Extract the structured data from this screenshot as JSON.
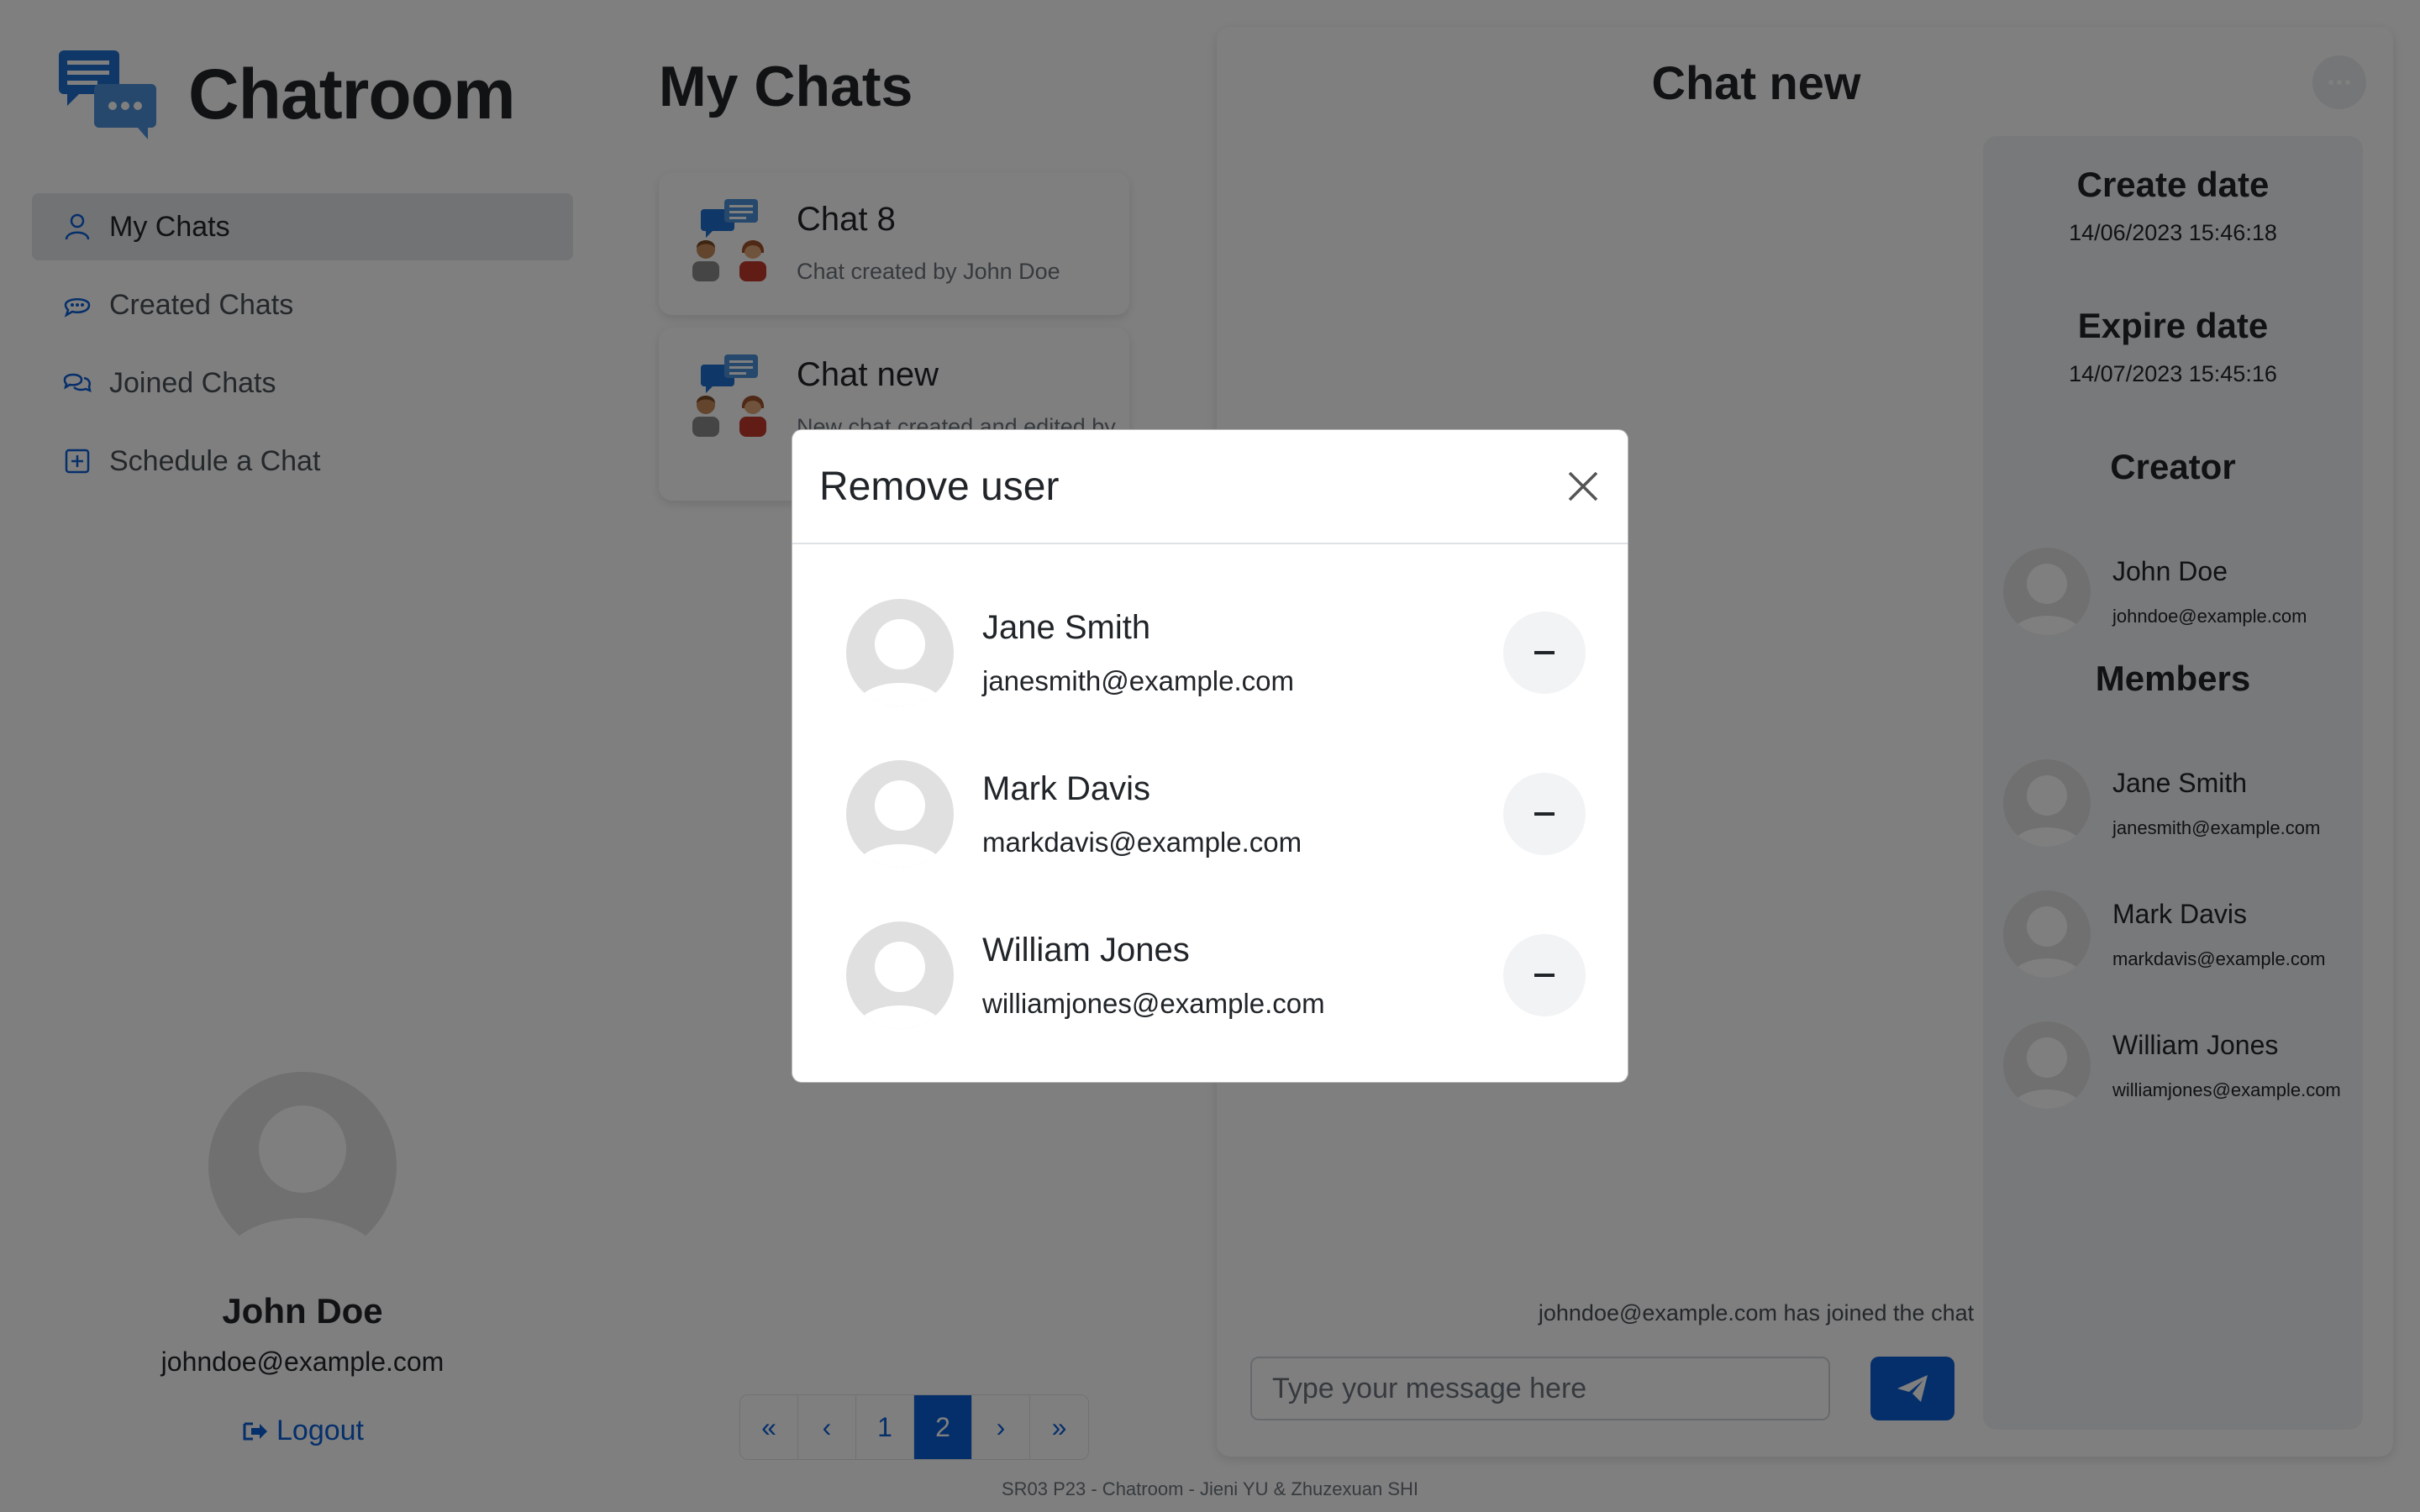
{
  "app": {
    "title": "Chatroom"
  },
  "sidebar": {
    "items": [
      {
        "label": "My Chats",
        "icon": "person-icon"
      },
      {
        "label": "Created Chats",
        "icon": "chat-dots-icon"
      },
      {
        "label": "Joined Chats",
        "icon": "chats-icon"
      },
      {
        "label": "Schedule a Chat",
        "icon": "plus-square-icon"
      }
    ],
    "user": {
      "name": "John Doe",
      "email": "johndoe@example.com"
    },
    "logout_label": "Logout"
  },
  "chat_list": {
    "title": "My Chats",
    "chats": [
      {
        "name": "Chat 8",
        "description": "Chat created by John Doe"
      },
      {
        "name": "Chat new",
        "description": "New chat created and edited by"
      }
    ],
    "pagination": {
      "first": "«",
      "prev": "‹",
      "pages": [
        "1",
        "2"
      ],
      "current": "2",
      "next": "›",
      "last": "»"
    }
  },
  "chat_panel": {
    "title": "Chat new",
    "system_message": "johndoe@example.com has joined the chat",
    "input_placeholder": "Type your message here",
    "info": {
      "create_date_label": "Create date",
      "create_date": "14/06/2023 15:46:18",
      "expire_date_label": "Expire date",
      "expire_date": "14/07/2023 15:45:16",
      "creator_label": "Creator",
      "creator": {
        "name": "John Doe",
        "email": "johndoe@example.com"
      },
      "members_label": "Members",
      "members": [
        {
          "name": "Jane Smith",
          "email": "janesmith@example.com"
        },
        {
          "name": "Mark Davis",
          "email": "markdavis@example.com"
        },
        {
          "name": "William Jones",
          "email": "williamjones@example.com"
        }
      ]
    }
  },
  "modal": {
    "title": "Remove user",
    "users": [
      {
        "name": "Jane Smith",
        "email": "janesmith@example.com"
      },
      {
        "name": "Mark Davis",
        "email": "markdavis@example.com"
      },
      {
        "name": "William Jones",
        "email": "williamjones@example.com"
      }
    ]
  },
  "footer": {
    "text": "SR03 P23 - Chatroom - Jieni YU & Zhuzexuan SHI"
  },
  "colors": {
    "primary": "#0b5ed7",
    "overlay": "rgba(0,0,0,0.5)",
    "avatar": "#e0e0e0"
  }
}
